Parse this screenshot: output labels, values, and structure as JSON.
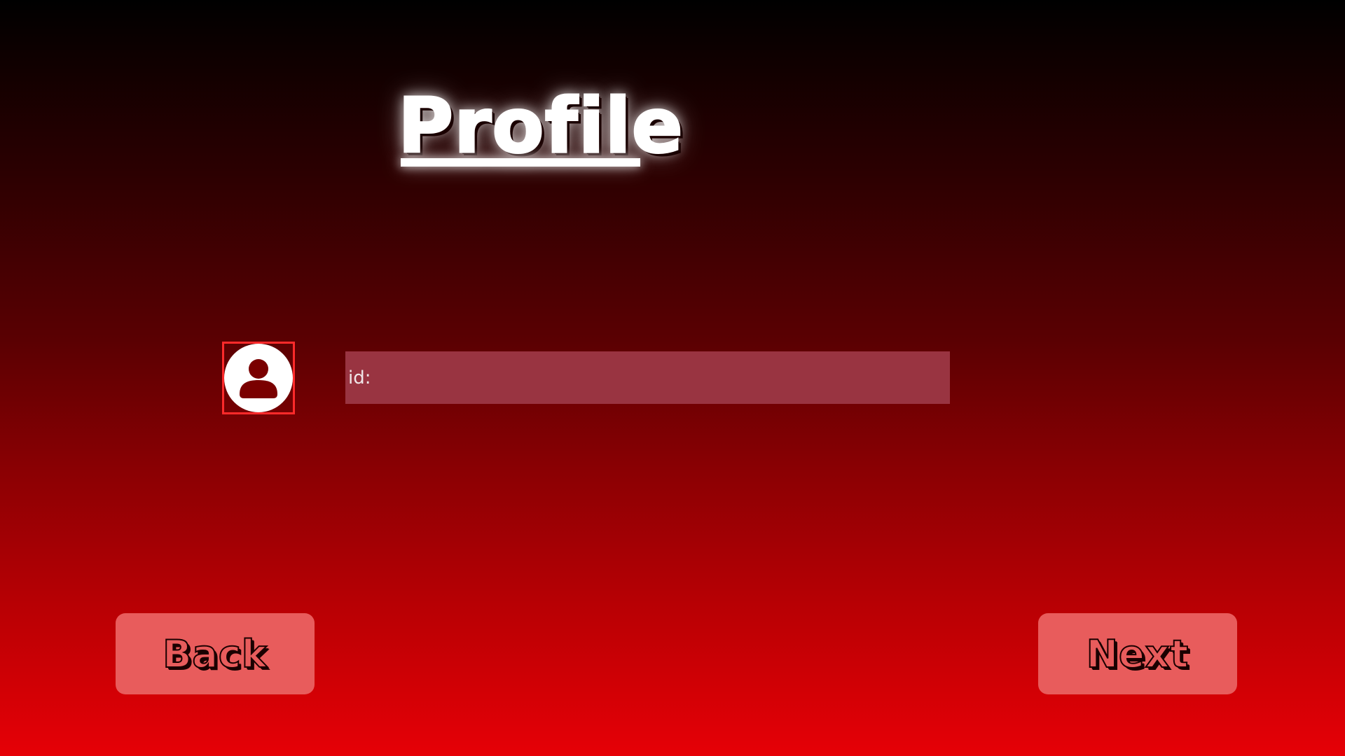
{
  "screen": {
    "title": "Profile"
  },
  "profile": {
    "avatar_icon": "user-icon",
    "id_label": "id:"
  },
  "navigation": {
    "back_label": "Back",
    "next_label": "Next"
  },
  "colors": {
    "gradient_top": "#000000",
    "gradient_bottom": "#e60006",
    "field_background": "#993441",
    "button_background": "#e85c5c",
    "avatar_border": "#ff2a2a"
  }
}
